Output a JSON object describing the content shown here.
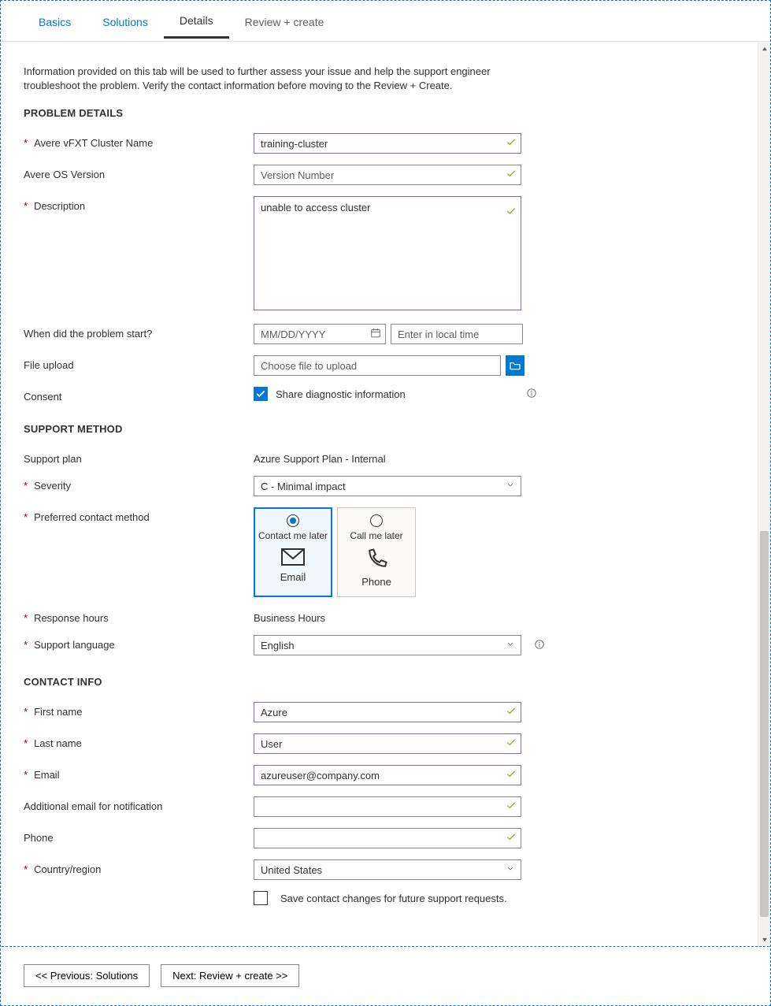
{
  "tabs": {
    "basics": "Basics",
    "solutions": "Solutions",
    "details": "Details",
    "review": "Review + create"
  },
  "intro": "Information provided on this tab will be used to further assess your issue and help the support engineer troubleshoot the problem. Verify the contact information before moving to the Review + Create.",
  "sections": {
    "problem": "PROBLEM DETAILS",
    "support": "SUPPORT METHOD",
    "contact": "CONTACT INFO"
  },
  "labels": {
    "cluster": "Avere vFXT Cluster Name",
    "os": "Avere OS Version",
    "desc": "Description",
    "when": "When did the problem start?",
    "file": "File upload",
    "consent": "Consent",
    "plan": "Support plan",
    "severity": "Severity",
    "pref": "Preferred contact method",
    "hours": "Response hours",
    "lang": "Support language",
    "first": "First name",
    "last": "Last name",
    "email": "Email",
    "addl": "Additional email for notification",
    "phone": "Phone",
    "country": "Country/region"
  },
  "values": {
    "cluster": "training-cluster",
    "os_ph": "Version Number",
    "desc": "unable to access cluster",
    "date_ph": "MM/DD/YYYY",
    "time_ph": "Enter in local time",
    "file_ph": "Choose file to upload",
    "consent_label": "Share diagnostic information",
    "plan": "Azure Support Plan - Internal",
    "severity": "C - Minimal impact",
    "card1_title": "Contact me later",
    "card1_sub": "Email",
    "card2_title": "Call me later",
    "card2_sub": "Phone",
    "hours": "Business Hours",
    "lang": "English",
    "first": "Azure",
    "last": "User",
    "email": "azureuser@company.com",
    "country": "United States",
    "save_label": "Save contact changes for future support requests."
  },
  "footer": {
    "prev": "<< Previous: Solutions",
    "next": "Next: Review + create >>"
  }
}
